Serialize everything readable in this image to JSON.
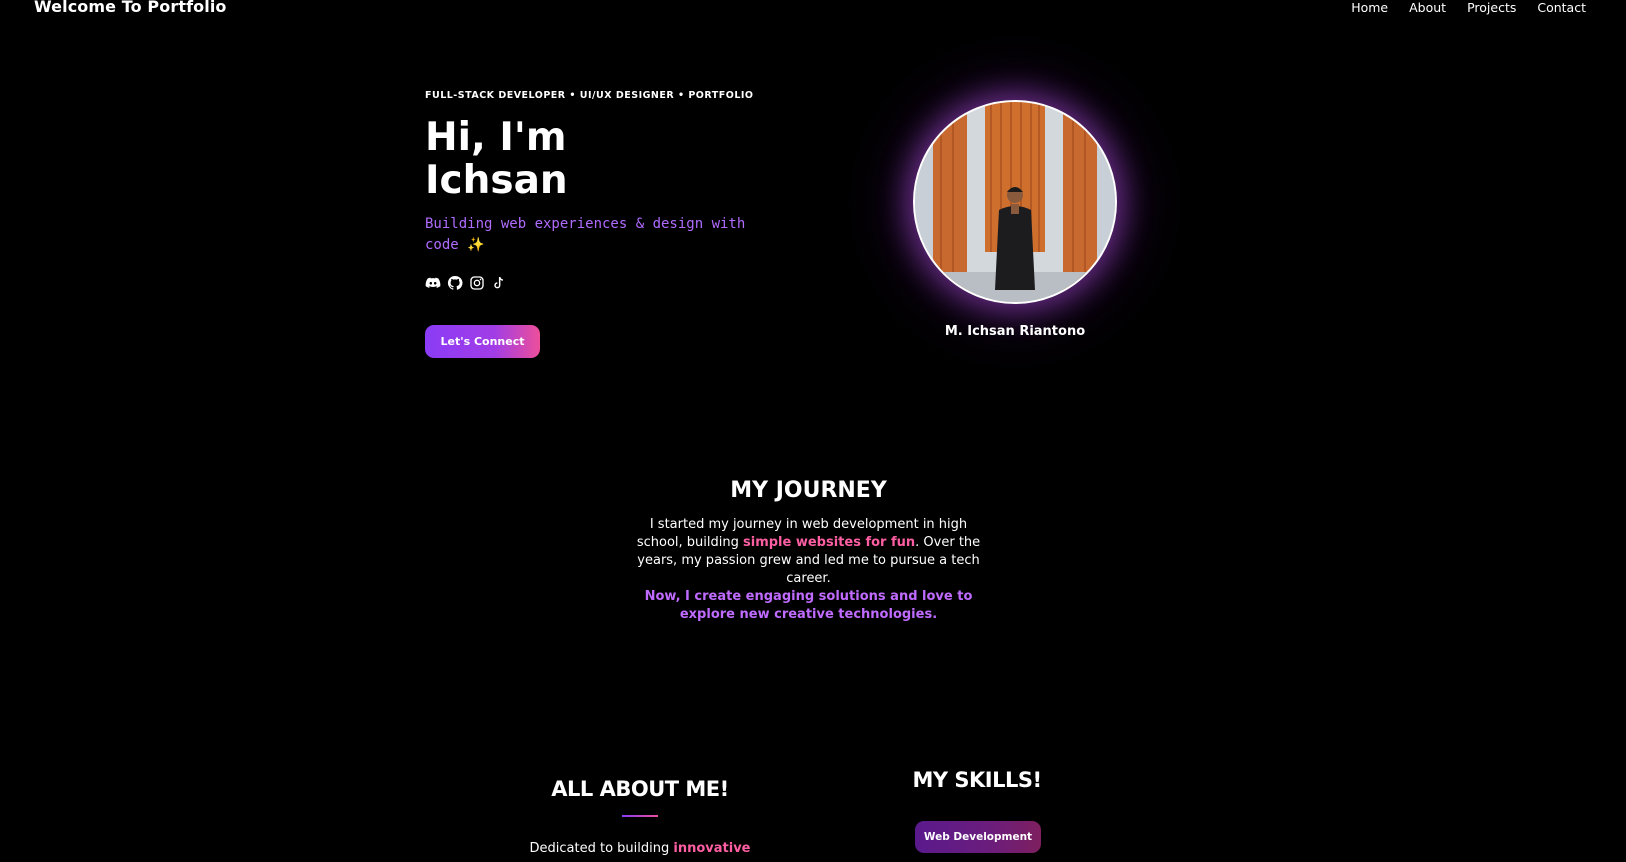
{
  "nav": {
    "brand": "Welcome To Portfolio",
    "links": [
      "Home",
      "About",
      "Projects",
      "Contact"
    ]
  },
  "hero": {
    "eyebrow": "FULL-STACK DEVELOPER • UI/UX DESIGNER • PORTFOLIO",
    "title_line1": "Hi, I'm",
    "title_line2": "Ichsan",
    "subtitle": "Building web experiences & design with code",
    "subtitle_emoji": "✨",
    "socials": [
      "discord-icon",
      "github-icon",
      "instagram-icon",
      "tiktok-icon"
    ],
    "cta_label": "Let's Connect",
    "profile_name": "M. Ichsan Riantono"
  },
  "journey": {
    "title": "MY JOURNEY",
    "text_1": "I started my journey in web development in high school, building ",
    "highlight_1": "simple websites for fun",
    "text_2": ". Over the years, my passion grew and led me to pursue a tech career.",
    "highlight_2": "Now, I create engaging solutions and love to explore new creative technologies."
  },
  "about": {
    "title": "ALL ABOUT ME!",
    "text_1": "Dedicated to building ",
    "highlight_1": "innovative"
  },
  "skills": {
    "title": "MY SKILLS!",
    "chips": [
      "Web Development"
    ]
  },
  "colors": {
    "background": "#000000",
    "accent_purple": "#8b3cf6",
    "accent_pink": "#ec4f9a",
    "highlight_pink": "#ff5fa2",
    "highlight_purple": "#c06bff"
  }
}
